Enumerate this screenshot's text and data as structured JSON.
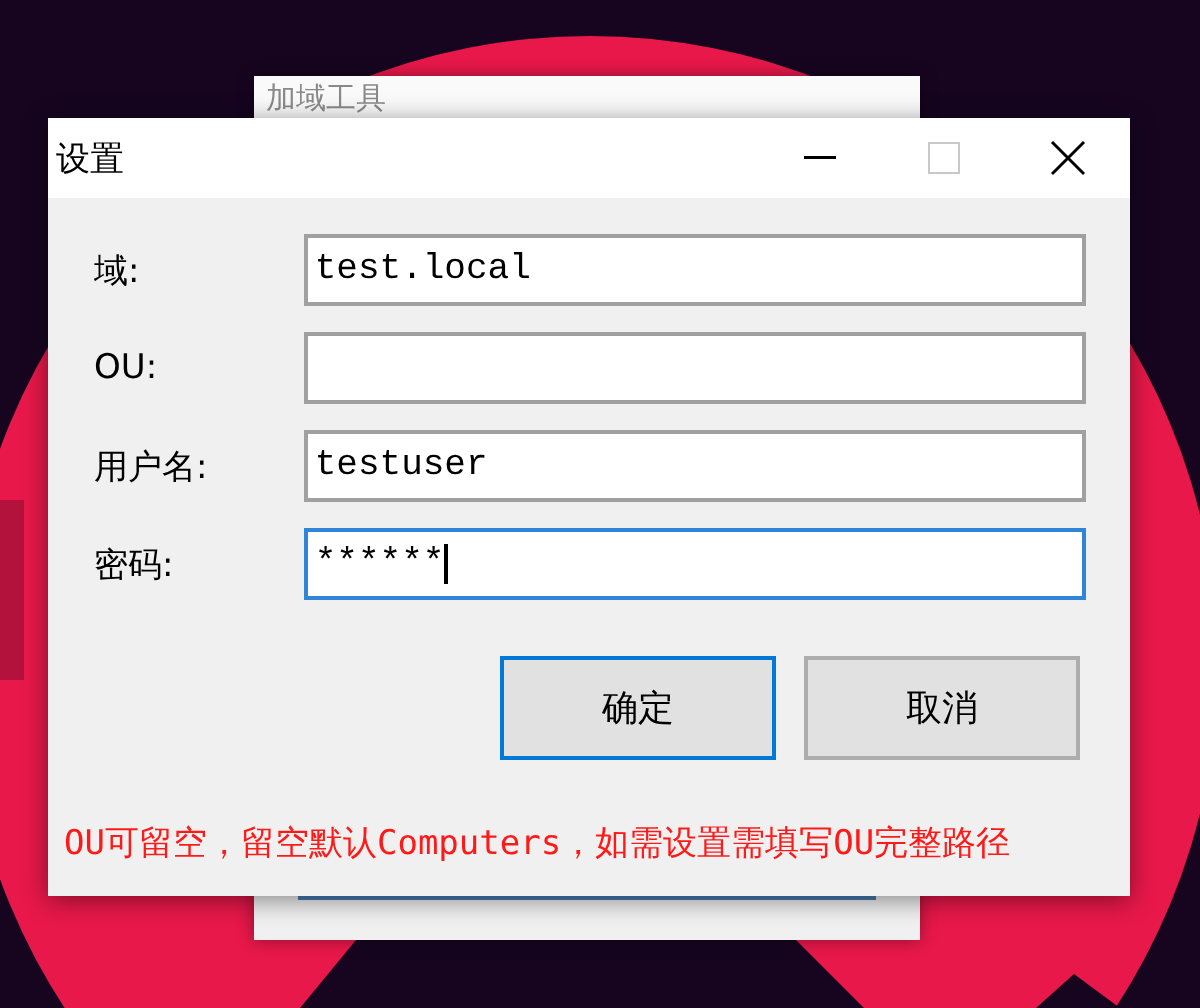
{
  "background_window": {
    "title": "加域工具"
  },
  "window": {
    "title": "设置"
  },
  "fields": [
    {
      "label": "域:",
      "value": "test.local",
      "focused": false
    },
    {
      "label": "OU:",
      "focused": false
    },
    {
      "label": "用户名:",
      "value": "testuser",
      "focused": false
    },
    {
      "label": "密码:",
      "value": "******",
      "focused": true
    }
  ],
  "buttons": [
    {
      "label": "确定",
      "default": true
    },
    {
      "label": "取消",
      "default": false
    }
  ],
  "note": "OU可留空，留空默认Computers，如需设置需填写OU完整路径"
}
